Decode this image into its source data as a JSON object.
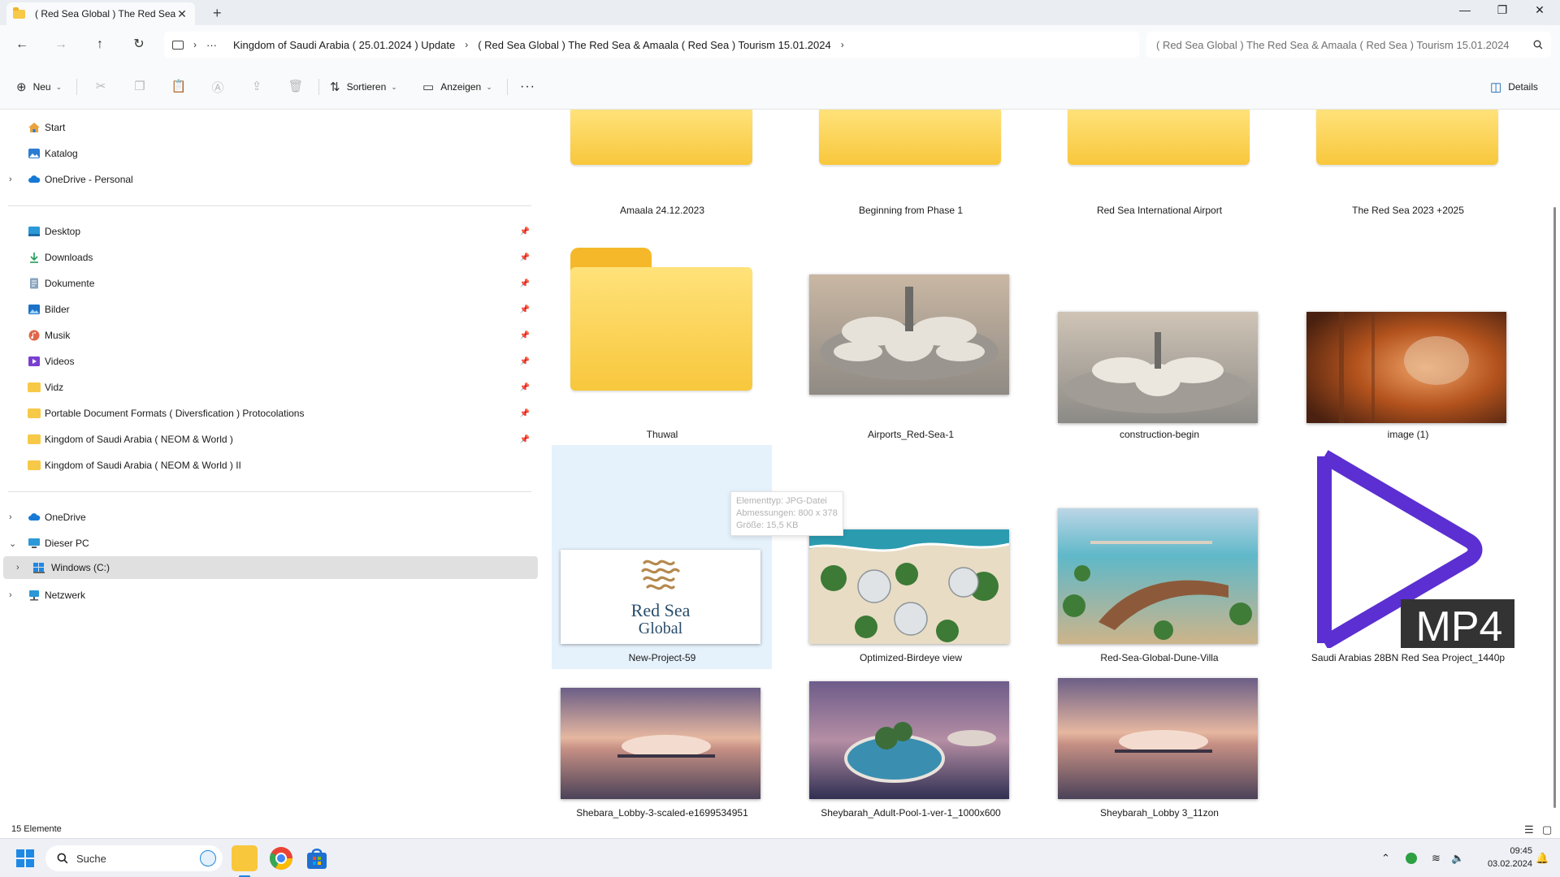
{
  "window": {
    "tab_title": "( Red Sea Global ) The Red Sea",
    "close_symbol": "✕",
    "new_tab_symbol": "+",
    "minimize_symbol": "—",
    "maximize_symbol": "❐",
    "close_window_symbol": "✕"
  },
  "address": {
    "back": "←",
    "forward": "→",
    "up": "↑",
    "refresh": "↻",
    "overflow": "···",
    "crumbs": [
      "Kingdom of Saudi Arabia ( 25.01.2024 ) Update",
      "( Red Sea Global ) The Red Sea & Amaala ( Red Sea ) Tourism 15.01.2024"
    ],
    "search_placeholder": "( Red Sea Global ) The Red Sea & Amaala ( Red Sea ) Tourism 15.01.2024"
  },
  "toolbar": {
    "new_label": "Neu",
    "sort_label": "Sortieren",
    "view_label": "Anzeigen",
    "more_label": "···",
    "details_label": "Details"
  },
  "sidebar": {
    "top": [
      {
        "label": "Start",
        "icon": "home-icon"
      },
      {
        "label": "Katalog",
        "icon": "gallery-icon"
      },
      {
        "label": "OneDrive - Personal",
        "icon": "cloud-icon"
      }
    ],
    "pinned": [
      {
        "label": "Desktop",
        "icon": "desktop-icon"
      },
      {
        "label": "Downloads",
        "icon": "download-icon"
      },
      {
        "label": "Dokumente",
        "icon": "document-icon"
      },
      {
        "label": "Bilder",
        "icon": "pictures-icon"
      },
      {
        "label": "Musik",
        "icon": "music-icon"
      },
      {
        "label": "Videos",
        "icon": "video-icon"
      },
      {
        "label": "Vidz",
        "icon": "folder-icon"
      },
      {
        "label": "Portable Document Formats ( Diversfication ) Protocolations",
        "icon": "folder-icon"
      },
      {
        "label": "Kingdom of Saudi Arabia ( NEOM & World  )",
        "icon": "folder-icon"
      },
      {
        "label": "Kingdom of Saudi Arabia ( NEOM & World ) II",
        "icon": "folder-icon"
      }
    ],
    "bottom": [
      {
        "label": "OneDrive",
        "icon": "cloud-icon"
      },
      {
        "label": "Dieser PC",
        "icon": "pc-icon"
      },
      {
        "label": "Windows (C:)",
        "icon": "drive-icon"
      },
      {
        "label": "Netzwerk",
        "icon": "network-icon"
      }
    ]
  },
  "items": [
    "Amaala 24.12.2023",
    "Beginning from Phase 1",
    "Red Sea International Airport",
    "The Red Sea 2023 +2025",
    "Thuwal",
    "Airports_Red-Sea-1",
    "construction-begin",
    "image (1)",
    "New-Project-59",
    "Optimized-Birdeye view",
    "Red-Sea-Global-Dune-Villa",
    "Saudi Arabias 28BN Red Sea Project_1440p",
    "Shebara_Lobby-3-scaled-e1699534951",
    "Sheybarah_Adult-Pool-1-ver-1_1000x600",
    "Sheybarah_Lobby 3_11zon"
  ],
  "thumb_text": {
    "logo_line1": "Red Sea",
    "logo_line2": "Global",
    "mp4": "MP4"
  },
  "tooltip": [
    "Elementtyp: JPG-Datei",
    "Abmessungen: 800 x 378",
    "Größe: 15,5 KB"
  ],
  "status": {
    "count": "15 Elemente"
  },
  "taskbar": {
    "search_label": "Suche",
    "time": "09:45",
    "date": "03.02.2024"
  },
  "colors": {
    "accent": "#1e88e5",
    "selection": "#e5f1fb",
    "folder": "#f7c948",
    "mp4_play": "#5b2fd1"
  }
}
